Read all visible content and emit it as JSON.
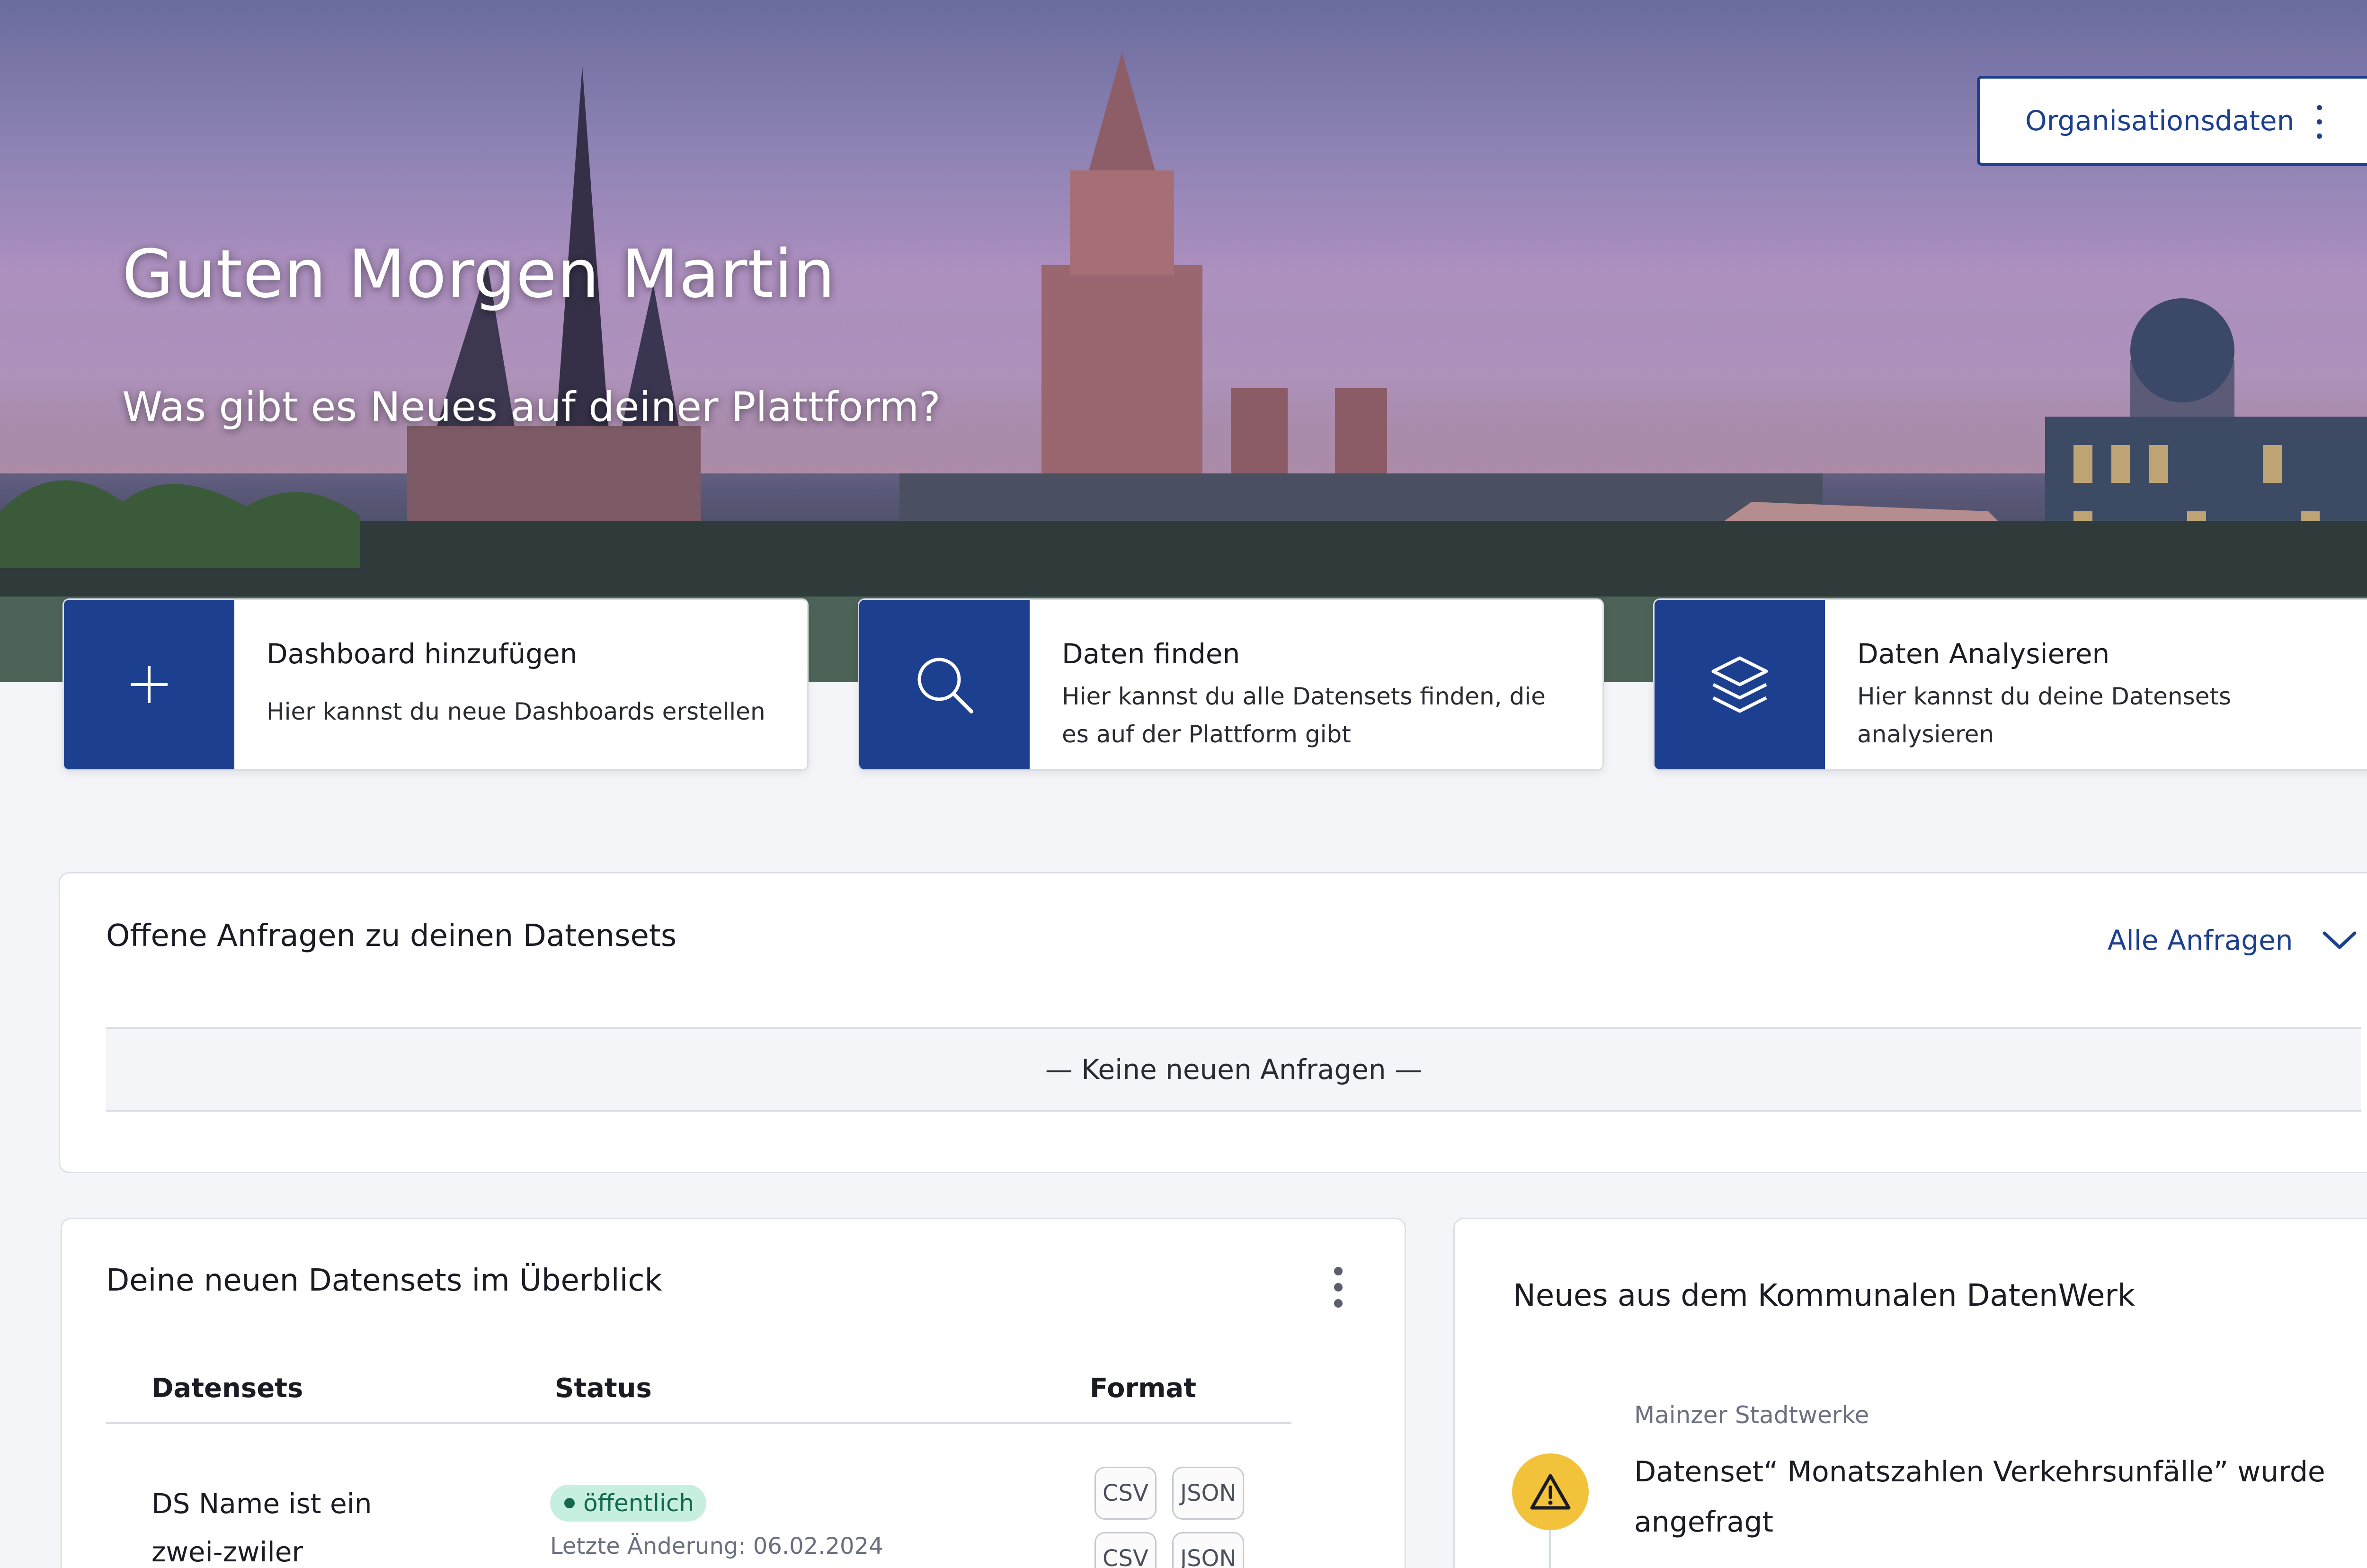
{
  "hero": {
    "greeting": "Guten Morgen Martin",
    "subtitle": "Was gibt es Neues auf deiner Plattform?",
    "org_button_label": "Organisationsdaten"
  },
  "actions": [
    {
      "title": "Dashboard hinzufügen",
      "description": "Hier kannst du neue Dashboards erstellen",
      "icon": "plus-icon"
    },
    {
      "title": "Daten finden",
      "description": "Hier kannst du alle Datensets finden, die es auf der Plattform gibt",
      "icon": "search-icon"
    },
    {
      "title": "Daten Analysieren",
      "description": "Hier kannst du deine Datensets analysieren",
      "icon": "layers-icon"
    }
  ],
  "requests": {
    "title": "Offene Anfragen zu deinen Datensets",
    "filter_label": "Alle Anfragen",
    "empty_text": "— Keine neuen Anfragen —"
  },
  "datasets": {
    "title": "Deine neuen Datensets im Überblick",
    "columns": [
      "Datensets",
      "Status",
      "Format"
    ],
    "rows": [
      {
        "name": "DS Name ist ein zwei-zwiler",
        "status": "öffentlich",
        "last_change": "Letzte Änderung: 06.02.2024",
        "formats": [
          "CSV",
          "JSON",
          "CSV",
          "JSON"
        ]
      }
    ]
  },
  "news": {
    "title": "Neues aus dem Kommunalen DatenWerk",
    "items": [
      {
        "source": "Mainzer Stadtwerke",
        "text": "Datenset“ Monatszahlen Verkehrsunfälle” wurde angefragt",
        "icon": "warning-icon"
      }
    ]
  },
  "colors": {
    "primary": "#1d3f8f",
    "badge_bg": "#c7efe0",
    "badge_text": "#13694e",
    "warning": "#f2c23a",
    "page_bg": "#f4f5f8"
  }
}
